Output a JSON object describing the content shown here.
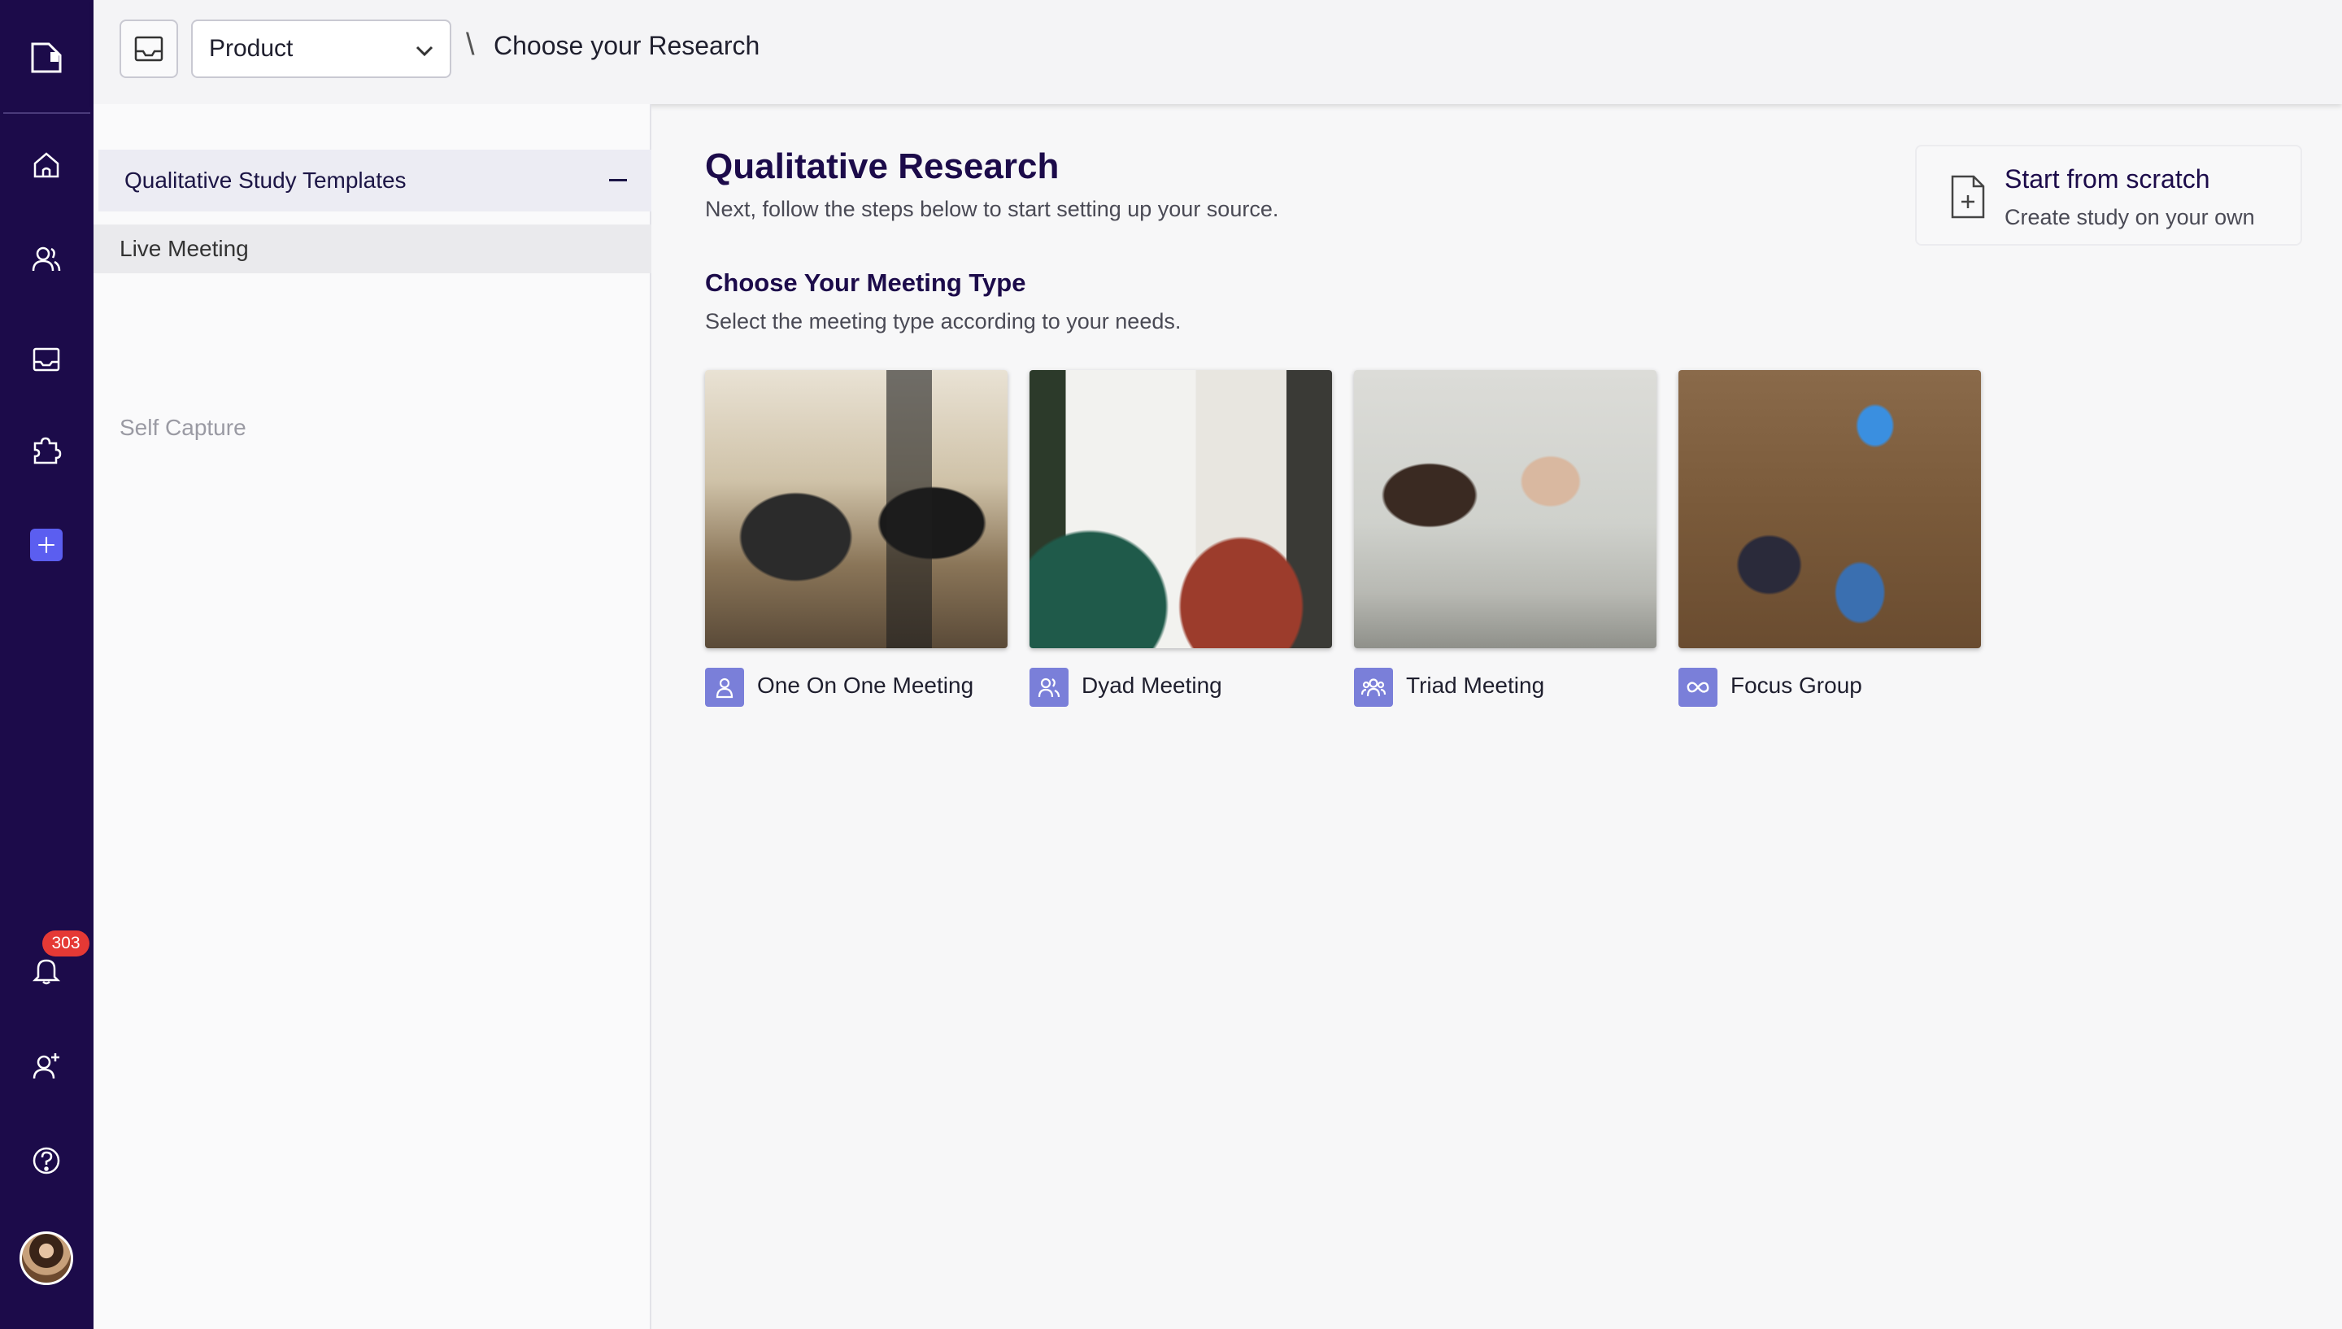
{
  "header": {
    "product_select": {
      "value": "Product"
    },
    "breadcrumb_separator": "\\",
    "breadcrumb_title": "Choose your Research"
  },
  "sidebar_rail": {
    "notifications_count": "303",
    "icons": [
      "logo-icon",
      "home-icon",
      "users-icon",
      "inbox-icon",
      "puzzle-icon",
      "plus-icon",
      "bell-icon",
      "add-user-icon",
      "help-icon"
    ]
  },
  "panel": {
    "group_title": "Qualitative Study Templates",
    "items": [
      {
        "label": "Live Meeting",
        "state": "active"
      },
      {
        "label": "Self Capture",
        "state": "disabled"
      }
    ]
  },
  "main": {
    "title": "Qualitative Research",
    "subtitle": "Next, follow the steps below to start setting up your source.",
    "section_title": "Choose Your Meeting Type",
    "section_subtitle": "Select the meeting type according to your needs.",
    "scratch": {
      "title": "Start from scratch",
      "subtitle": "Create study on your own"
    },
    "meeting_types": [
      {
        "label": "One On One Meeting",
        "icon": "person-icon"
      },
      {
        "label": "Dyad Meeting",
        "icon": "two-people-icon"
      },
      {
        "label": "Triad Meeting",
        "icon": "group-icon"
      },
      {
        "label": "Focus Group",
        "icon": "infinity-icon"
      }
    ]
  },
  "colors": {
    "rail": "#1c0b4a",
    "accent": "#5b5ef0",
    "icon_tile": "#7a7fd9",
    "badge": "#e53935"
  }
}
